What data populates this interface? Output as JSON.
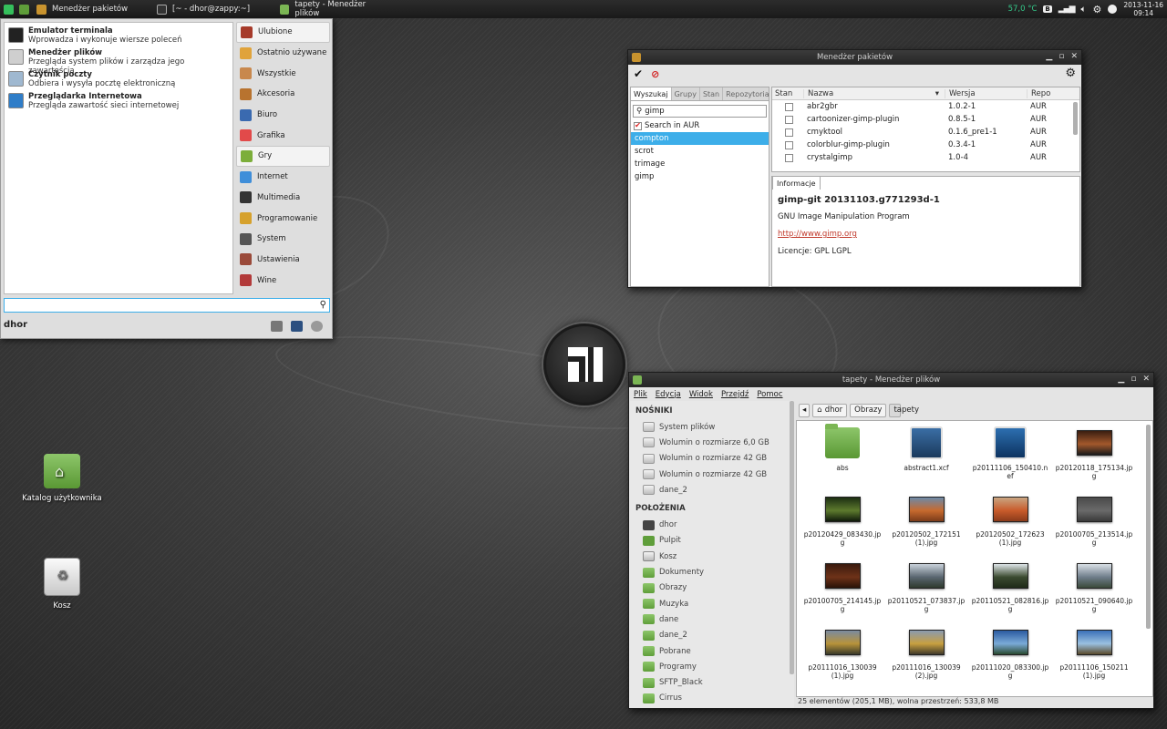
{
  "panel": {
    "tasks": [
      {
        "label": "Menedżer pakietów",
        "icon": "package-icon"
      },
      {
        "label": "[~ - dhor@zappy:~]",
        "icon": "terminal-icon"
      },
      {
        "label": "tapety - Menedżer plików",
        "icon": "folder-icon"
      }
    ],
    "temperature": "57,0 °C",
    "battery": "B",
    "date": "2013-11-16",
    "time": "09:14"
  },
  "menu": {
    "favorites": [
      {
        "title": "Emulator terminala",
        "desc": "Wprowadza i wykonuje wiersze poleceń",
        "icon": "terminal-icon",
        "color": "#222222"
      },
      {
        "title": "Menedżer plików",
        "desc": "Przegląda system plików i zarządza jego zawartością",
        "icon": "file-manager-icon",
        "color": "#cfcfcf"
      },
      {
        "title": "Czytnik poczty",
        "desc": "Odbiera i wysyła pocztę elektroniczną",
        "icon": "mail-icon",
        "color": "#9fb8d0"
      },
      {
        "title": "Przeglądarka Internetowa",
        "desc": "Przegląda zawartość sieci internetowej",
        "icon": "browser-icon",
        "color": "#2f7dc8"
      }
    ],
    "categories": [
      {
        "label": "Ulubione",
        "icon": "favorites-icon",
        "color": "#a63a2a"
      },
      {
        "label": "Ostatnio używane",
        "icon": "recent-icon",
        "color": "#e0a33b"
      },
      {
        "label": "Wszystkie",
        "icon": "all-apps-icon",
        "color": "#c8884d"
      },
      {
        "label": "Akcesoria",
        "icon": "accessories-icon",
        "color": "#b8732f"
      },
      {
        "label": "Biuro",
        "icon": "office-icon",
        "color": "#3a6ab0"
      },
      {
        "label": "Grafika",
        "icon": "graphics-icon",
        "color": "#e24a4a"
      },
      {
        "label": "Gry",
        "icon": "games-icon",
        "color": "#7cae3a"
      },
      {
        "label": "Internet",
        "icon": "internet-icon",
        "color": "#3f8ed9"
      },
      {
        "label": "Multimedia",
        "icon": "multimedia-icon",
        "color": "#333333"
      },
      {
        "label": "Programowanie",
        "icon": "programming-icon",
        "color": "#d6a12c"
      },
      {
        "label": "System",
        "icon": "system-icon",
        "color": "#555555"
      },
      {
        "label": "Ustawienia",
        "icon": "settings-icon",
        "color": "#9a4a3a"
      },
      {
        "label": "Wine",
        "icon": "wine-icon",
        "color": "#b23a3a"
      }
    ],
    "selected_category": "Gry",
    "search_value": "",
    "user": "dhor"
  },
  "package_manager": {
    "title": "Menedżer pakietów",
    "tabs": [
      "Wyszukaj",
      "Grupy",
      "Stan",
      "Repozytoria"
    ],
    "search_value": "gimp",
    "search_in_aur": "Search in AUR",
    "history": [
      "compton",
      "scrot",
      "trimage",
      "gimp"
    ],
    "selected_history": "compton",
    "columns": [
      "Stan",
      "Nazwa",
      "Wersja",
      "Repo"
    ],
    "rows": [
      {
        "name": "abr2gbr",
        "version": "1.0.2-1",
        "repo": "AUR"
      },
      {
        "name": "cartoonizer-gimp-plugin",
        "version": "0.8.5-1",
        "repo": "AUR"
      },
      {
        "name": "cmyktool",
        "version": "0.1.6_pre1-1",
        "repo": "AUR"
      },
      {
        "name": "colorblur-gimp-plugin",
        "version": "0.3.4-1",
        "repo": "AUR"
      },
      {
        "name": "crystalgimp",
        "version": "1.0-4",
        "repo": "AUR"
      }
    ],
    "info_tab": "Informacje",
    "info": {
      "name": "gimp-git  20131103.g771293d-1",
      "description": "GNU Image Manipulation Program",
      "url": "http://www.gimp.org",
      "license": "Licencje: GPL LGPL"
    }
  },
  "file_manager": {
    "title": "tapety - Menedżer plików",
    "menu": [
      "Plik",
      "Edycja",
      "Widok",
      "Przejdź",
      "Pomoc"
    ],
    "devices_header": "NOŚNIKI",
    "devices": [
      "System plików",
      "Wolumin o rozmiarze 6,0 GB",
      "Wolumin o rozmiarze 42 GB",
      "Wolumin o rozmiarze 42 GB",
      "dane_2"
    ],
    "places_header": "POŁOŻENIA",
    "places": [
      {
        "label": "dhor",
        "icon": "home-icon"
      },
      {
        "label": "Pulpit",
        "icon": "desktop-icon"
      },
      {
        "label": "Kosz",
        "icon": "trash-icon"
      },
      {
        "label": "Dokumenty",
        "icon": "folder-icon"
      },
      {
        "label": "Obrazy",
        "icon": "folder-icon"
      },
      {
        "label": "Muzyka",
        "icon": "folder-icon"
      },
      {
        "label": "dane",
        "icon": "folder-icon"
      },
      {
        "label": "dane_2",
        "icon": "folder-icon"
      },
      {
        "label": "Pobrane",
        "icon": "folder-icon"
      },
      {
        "label": "Programy",
        "icon": "folder-icon"
      },
      {
        "label": "SFTP_Black",
        "icon": "network-folder-icon"
      },
      {
        "label": "Cirrus",
        "icon": "network-folder-icon"
      }
    ],
    "breadcrumb": [
      "dhor",
      "Obrazy",
      "tapety"
    ],
    "files": [
      {
        "name": "abs",
        "kind": "folder"
      },
      {
        "name": "abstract1.xcf",
        "kind": "xcf"
      },
      {
        "name": "p20111106_150410.nef",
        "kind": "nef"
      },
      {
        "name": "p20120118_175134.jpg",
        "kind": "photo",
        "colors": [
          "#3a1e10",
          "#a2582c",
          "#1b1b1b"
        ]
      },
      {
        "name": "p20120429_083430.jpg",
        "kind": "photo",
        "colors": [
          "#1c2e12",
          "#5d7a2e",
          "#0f1a0a"
        ]
      },
      {
        "name": "p20120502_172151 (1).jpg",
        "kind": "photo",
        "colors": [
          "#6d89a8",
          "#c76a2e",
          "#7a3b1a"
        ]
      },
      {
        "name": "p20120502_172623 (1).jpg",
        "kind": "photo",
        "colors": [
          "#c9a581",
          "#c95b2b",
          "#8a3a1a"
        ]
      },
      {
        "name": "p20100705_213514.jpg",
        "kind": "photo",
        "colors": [
          "#4a4a4a",
          "#6a6a6a",
          "#3a3a3a"
        ]
      },
      {
        "name": "p20100705_214145.jpg",
        "kind": "photo",
        "colors": [
          "#3a1a0e",
          "#6e3218",
          "#2a1208"
        ]
      },
      {
        "name": "p20110521_073837.jpg",
        "kind": "photo",
        "colors": [
          "#c9d2db",
          "#5a6670",
          "#2e3a2e"
        ]
      },
      {
        "name": "p20110521_082816.jpg",
        "kind": "photo",
        "colors": [
          "#dfe6ea",
          "#3b4a30",
          "#1e2a18"
        ]
      },
      {
        "name": "p20110521_090640.jpg",
        "kind": "photo",
        "colors": [
          "#d9e0e6",
          "#6f7d8a",
          "#3b4a3a"
        ]
      },
      {
        "name": "p20111016_130039 (1).jpg",
        "kind": "photo",
        "colors": [
          "#7a8aa0",
          "#b8933a",
          "#3a3a2a"
        ]
      },
      {
        "name": "p20111016_130039 (2).jpg",
        "kind": "photo",
        "colors": [
          "#8a9ab0",
          "#c8a040",
          "#403a2a"
        ]
      },
      {
        "name": "p20111020_083300.jpg",
        "kind": "photo",
        "colors": [
          "#2a5aa0",
          "#7aaad8",
          "#2a4a30"
        ]
      },
      {
        "name": "p20111106_150211 (1).jpg",
        "kind": "photo",
        "colors": [
          "#3a70b8",
          "#9ac0e0",
          "#5a4a2a"
        ]
      }
    ],
    "status": "25 elementów (205,1 MB), wolna przestrzeń: 533,8 MB"
  },
  "desktop": {
    "icons": [
      {
        "label": "Katalog użytkownika",
        "icon": "home-folder-icon"
      },
      {
        "label": "Kosz",
        "icon": "trash-icon"
      }
    ]
  }
}
